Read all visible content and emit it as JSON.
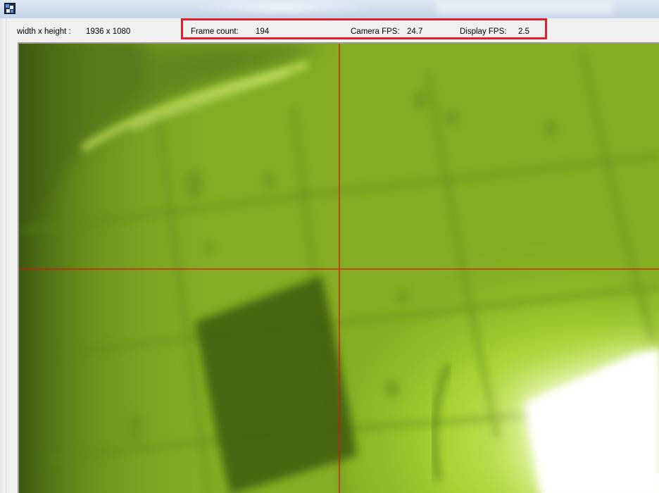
{
  "window": {
    "title": "",
    "icon": "app-icon"
  },
  "info": {
    "resolution_label": "width x height :",
    "resolution_value": "1936 x 1080",
    "frame_count_label": "Frame count:",
    "frame_count_value": "194",
    "camera_fps_label": "Camera FPS:",
    "camera_fps_value": "24.7",
    "display_fps_label": "Display FPS:",
    "display_fps_value": "2.5"
  },
  "video": {
    "description": "",
    "crosshair_color": "#e01010",
    "tint_color": "#8dbd24"
  },
  "colors": {
    "highlight_box": "#e0202c"
  }
}
